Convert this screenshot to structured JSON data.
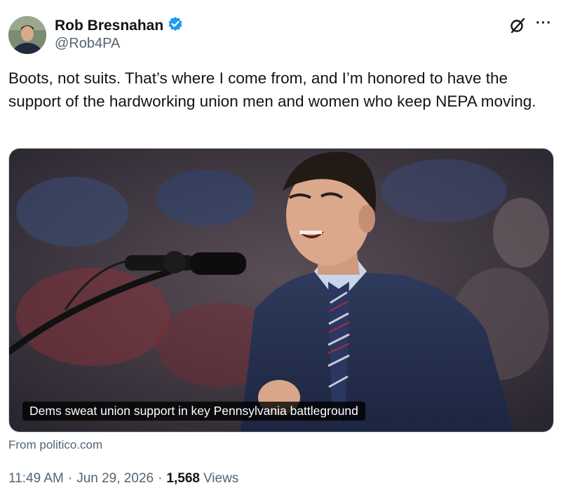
{
  "author": {
    "display_name": "Rob Bresnahan",
    "handle": "@Rob4PA",
    "verified": true,
    "verified_color": "#1d9bf0"
  },
  "post": {
    "text": "Boots, not suits. That’s where I come from, and I’m honored to have the support of the hardworking union men and women who keep NEPA moving."
  },
  "link_card": {
    "caption": "Dems sweat union support in key Pennsylvania battleground",
    "source": "From politico.com"
  },
  "meta": {
    "time": "11:49 AM",
    "date": "Jun 29, 2026",
    "separator": "·",
    "views_count": "1,568",
    "views_label": "Views"
  },
  "icons": {
    "platform_logo": "grok-slash-icon",
    "more": "more-options-icon",
    "more_glyph": "···"
  }
}
